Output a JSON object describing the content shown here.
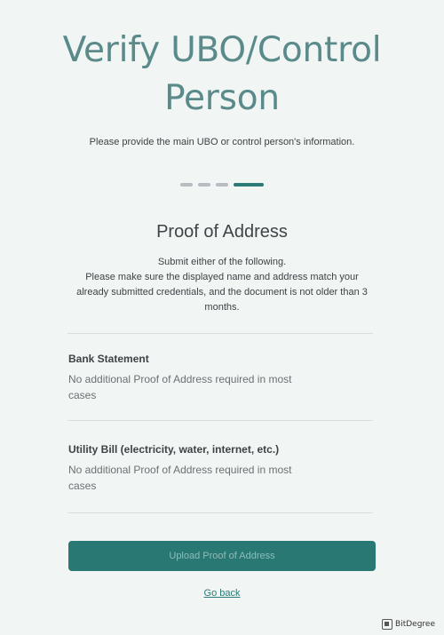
{
  "header": {
    "title": "Verify UBO/Control Person",
    "subtitle": "Please provide the main UBO or control person's information."
  },
  "stepper": {
    "total_steps": 4,
    "current_step": 4
  },
  "section": {
    "title": "Proof of Address",
    "instructions": "Submit either of the following.\nPlease make sure the displayed name and address match your already submitted credentials, and the document is not older than 3 months."
  },
  "options": [
    {
      "title": "Bank Statement",
      "description": "No additional Proof of Address required in most cases"
    },
    {
      "title": "Utility Bill (electricity, water, internet, etc.)",
      "description": "No additional Proof of Address required in most cases"
    }
  ],
  "actions": {
    "upload_label": "Upload Proof of Address",
    "back_label": "Go back"
  },
  "watermark": {
    "text": "BitDegree"
  },
  "colors": {
    "accent": "#2a7874",
    "title": "#5a8a8a",
    "background": "#f1f5f4"
  }
}
